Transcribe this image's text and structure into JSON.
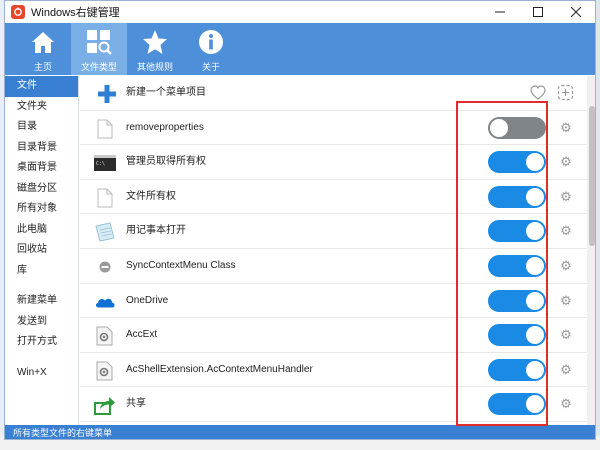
{
  "window": {
    "title": "Windows右键管理",
    "controls": [
      "minimize",
      "maximize",
      "close"
    ]
  },
  "toolbar": {
    "items": [
      {
        "label": "主页",
        "icon": "home-icon",
        "active": false
      },
      {
        "label": "文件类型",
        "icon": "file-search-icon",
        "active": true
      },
      {
        "label": "其他规则",
        "icon": "star-icon",
        "active": false
      },
      {
        "label": "关于",
        "icon": "info-icon",
        "active": false
      }
    ]
  },
  "sidebar": {
    "items": [
      {
        "label": "文件",
        "active": true
      },
      {
        "label": "文件夹"
      },
      {
        "label": "目录"
      },
      {
        "label": "目录背景"
      },
      {
        "label": "桌面背景"
      },
      {
        "label": "磁盘分区"
      },
      {
        "label": "所有对象"
      },
      {
        "label": "此电脑"
      },
      {
        "label": "回收站"
      },
      {
        "label": "库"
      },
      {
        "label": "新建菜单"
      },
      {
        "label": "发送到"
      },
      {
        "label": "打开方式"
      },
      {
        "label": "Win+X"
      }
    ]
  },
  "content": {
    "new_item_label": "新建一个菜单项目",
    "rows": [
      {
        "label": "removeproperties",
        "icon": "blank-file-icon",
        "enabled": false
      },
      {
        "label": "管理员取得所有权",
        "icon": "cmd-icon",
        "enabled": true
      },
      {
        "label": "文件所有权",
        "icon": "blank-file-icon",
        "enabled": true
      },
      {
        "label": "用记事本打开",
        "icon": "notepad-icon",
        "enabled": true
      },
      {
        "label": "SyncContextMenu Class",
        "icon": "minus-circle-icon",
        "enabled": true
      },
      {
        "label": "OneDrive",
        "icon": "onedrive-cloud-icon",
        "enabled": true
      },
      {
        "label": "AccExt",
        "icon": "settings-file-icon",
        "enabled": true
      },
      {
        "label": "AcShellExtension.AcContextMenuHandler",
        "icon": "settings-file-icon",
        "enabled": true
      },
      {
        "label": "共享",
        "icon": "share-arrow-icon",
        "enabled": true
      }
    ]
  },
  "statusbar": {
    "text": "所有类型文件的右键菜单"
  },
  "colors": {
    "accent": "#3a80d2",
    "toolbar": "#4e8fd9",
    "toggle_on": "#1a8ae5",
    "toggle_off": "#7f8589",
    "highlight": "#e32b2b"
  }
}
